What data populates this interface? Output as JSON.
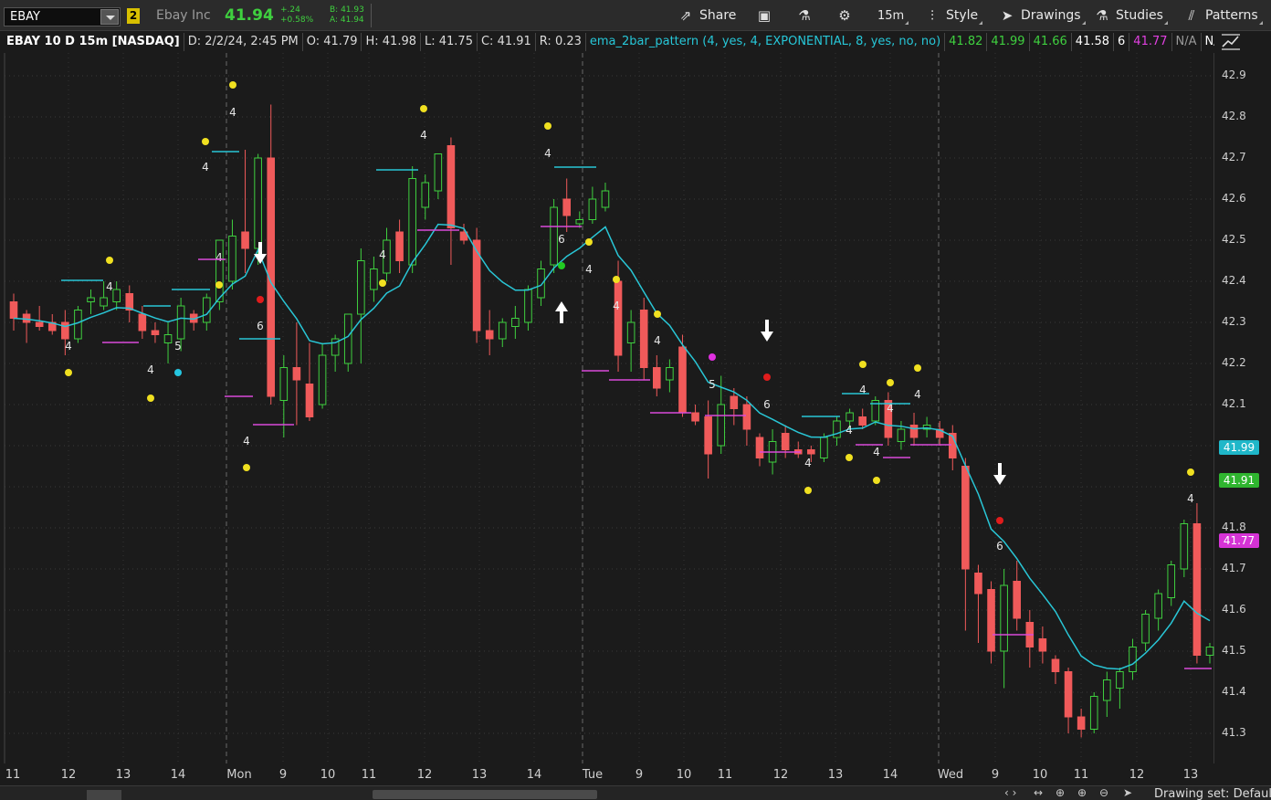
{
  "toolbar": {
    "symbol": "EBAY",
    "link_group": "2",
    "company": "Ebay Inc",
    "last": "41.94",
    "change": "+.24",
    "change_pct": "+0.58%",
    "bid": "B: 41.93",
    "ask": "A: 41.94",
    "share": "Share",
    "timeframe": "15m",
    "style": "Style",
    "drawings": "Drawings",
    "studies": "Studies",
    "patterns": "Patterns"
  },
  "info": {
    "title": "EBAY 10 D 15m [NASDAQ]",
    "date": "D: 2/2/24, 2:45 PM",
    "open": "O: 41.79",
    "high": "H: 41.98",
    "low": "L: 41.75",
    "close": "C: 41.91",
    "range": "R: 0.23",
    "study": "ema_2bar_pattern (4, yes, 4, EXPONENTIAL, 8, yes, no, no)",
    "v1": "41.82",
    "v2": "41.99",
    "v3": "41.66",
    "v4": "41.58",
    "v5": "6",
    "v6": "41.77",
    "v7": "N/A",
    "v8": "N/A",
    "more": "..."
  },
  "price_axis": {
    "labels": [
      "42.9",
      "42.8",
      "42.7",
      "42.6",
      "42.5",
      "42.4",
      "42.3",
      "42.2",
      "42.1",
      "41.8",
      "41.7",
      "41.6",
      "41.5",
      "41.4",
      "41.3"
    ],
    "tag_cyan": "41.99",
    "tag_green": "41.91",
    "tag_magenta": "41.77"
  },
  "time_axis": [
    "11",
    "12",
    "13",
    "14",
    "Mon",
    "9",
    "10",
    "11",
    "12",
    "13",
    "14",
    "Tue",
    "9",
    "10",
    "11",
    "12",
    "13",
    "14",
    "Wed",
    "9",
    "10",
    "11",
    "12",
    "13"
  ],
  "bottom": {
    "drawing_set": "Drawing set: Default"
  },
  "colors": {
    "up": "#3fd03f",
    "down": "#f05a5a",
    "ema": "#29c6d6",
    "bg": "#1b1b1b",
    "dot": "#f0e020"
  }
}
